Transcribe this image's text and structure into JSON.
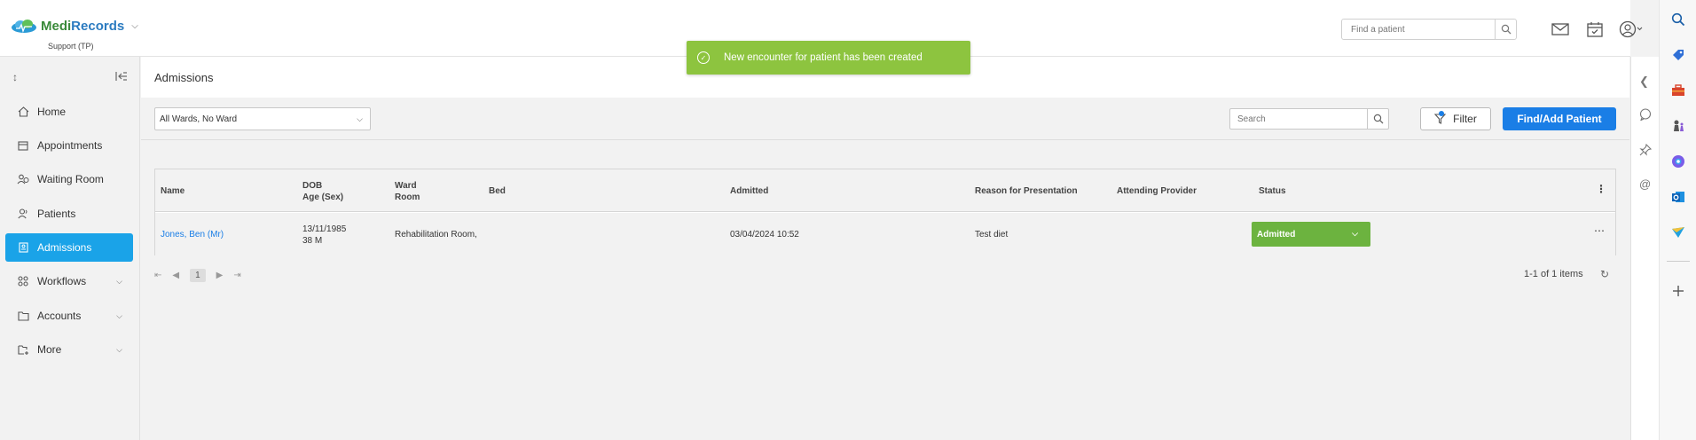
{
  "brand": {
    "name_part1": "Medi",
    "name_part2": "Records",
    "sub": "Support (TP)"
  },
  "header": {
    "find_placeholder": "Find a patient"
  },
  "toast": {
    "message": "New encounter for patient has been created"
  },
  "nav": [
    {
      "label": "Home",
      "icon": "home-icon"
    },
    {
      "label": "Appointments",
      "icon": "calendar-icon"
    },
    {
      "label": "Waiting Room",
      "icon": "waiting-room-icon"
    },
    {
      "label": "Patients",
      "icon": "patients-icon"
    },
    {
      "label": "Admissions",
      "icon": "admissions-icon",
      "active": true
    },
    {
      "label": "Workflows",
      "icon": "workflows-icon"
    },
    {
      "label": "Accounts",
      "icon": "accounts-icon"
    },
    {
      "label": "More",
      "icon": "more-icon"
    }
  ],
  "page": {
    "title": "Admissions"
  },
  "toolbar": {
    "ward_select": "All Wards, No Ward",
    "search_placeholder": "Search",
    "filter_label": "Filter",
    "find_add_label": "Find/Add Patient"
  },
  "grid": {
    "headers": {
      "name": "Name",
      "dob": "DOB",
      "age_sex": "Age (Sex)",
      "ward": "Ward",
      "room": "Room",
      "bed": "Bed",
      "admitted": "Admitted",
      "reason": "Reason for Presentation",
      "provider": "Attending Provider",
      "status": "Status"
    },
    "rows": [
      {
        "name": "Jones, Ben (Mr)",
        "dob": "13/11/1985",
        "age_sex": "38 M",
        "ward_room": "Rehabilitation Room,",
        "bed": "",
        "admitted": "03/04/2024 10:52",
        "reason": "Test diet",
        "provider": "",
        "status": "Admitted"
      }
    ]
  },
  "pager": {
    "page": "1",
    "info": "1-1 of 1 items"
  },
  "colors": {
    "accent": "#1a7ee6",
    "active_nav": "#1aa3e8",
    "toast": "#8dc43f",
    "status_admitted": "#6cb33f"
  }
}
